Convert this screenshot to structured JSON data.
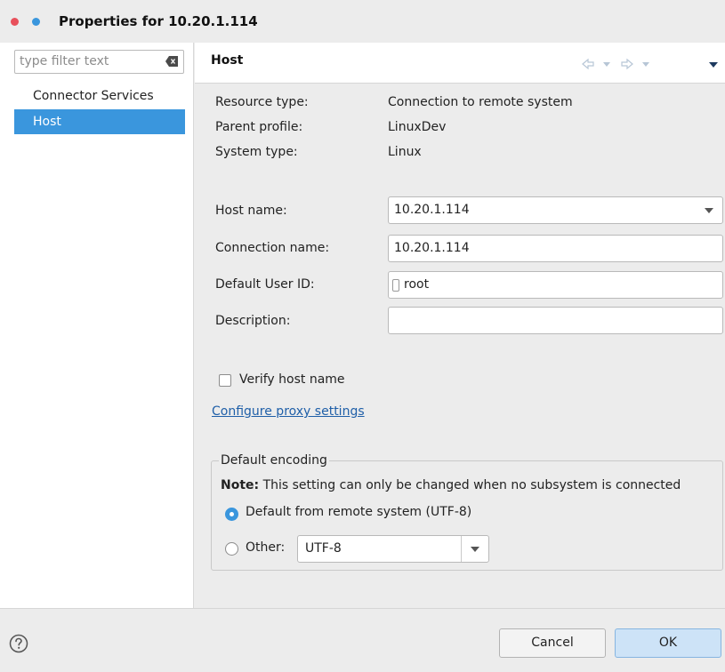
{
  "window": {
    "title": "Properties for 10.20.1.114"
  },
  "sidebar": {
    "filter_placeholder": "type filter text",
    "items": [
      {
        "label": "Connector Services",
        "selected": false
      },
      {
        "label": "Host",
        "selected": true
      }
    ]
  },
  "page": {
    "title": "Host",
    "info": [
      {
        "label": "Resource type:",
        "value": "Connection to remote system"
      },
      {
        "label": "Parent profile:",
        "value": "LinuxDev"
      },
      {
        "label": "System type:",
        "value": "Linux"
      }
    ],
    "fields": {
      "host_name": {
        "label": "Host name:",
        "value": "10.20.1.114"
      },
      "connection_name": {
        "label": "Connection name:",
        "value": "10.20.1.114"
      },
      "user_id": {
        "label": "Default User ID:",
        "value": "root"
      },
      "description": {
        "label": "Description:",
        "value": ""
      }
    },
    "verify_host": {
      "label": "Verify host name",
      "checked": false
    },
    "proxy_link": "Configure proxy settings",
    "encoding": {
      "group_title": "Default encoding",
      "note_bold": "Note:",
      "note_text": " This setting can only be changed when no subsystem is connected",
      "option_default": {
        "label": "Default from remote system (UTF-8)",
        "selected": true
      },
      "option_other": {
        "label": "Other:",
        "selected": false,
        "value": "UTF-8"
      }
    }
  },
  "footer": {
    "cancel_label": "Cancel",
    "ok_label": "OK"
  },
  "icons": {
    "help": "help-icon",
    "clear": "clear-filter-icon",
    "back": "back-arrow-icon",
    "forward": "forward-arrow-icon",
    "menu": "view-menu-icon",
    "dropdown": "chevron-down-icon"
  },
  "colors": {
    "accent": "#3a96dd",
    "close_dot": "#e8505b",
    "link": "#1f5fa8"
  }
}
